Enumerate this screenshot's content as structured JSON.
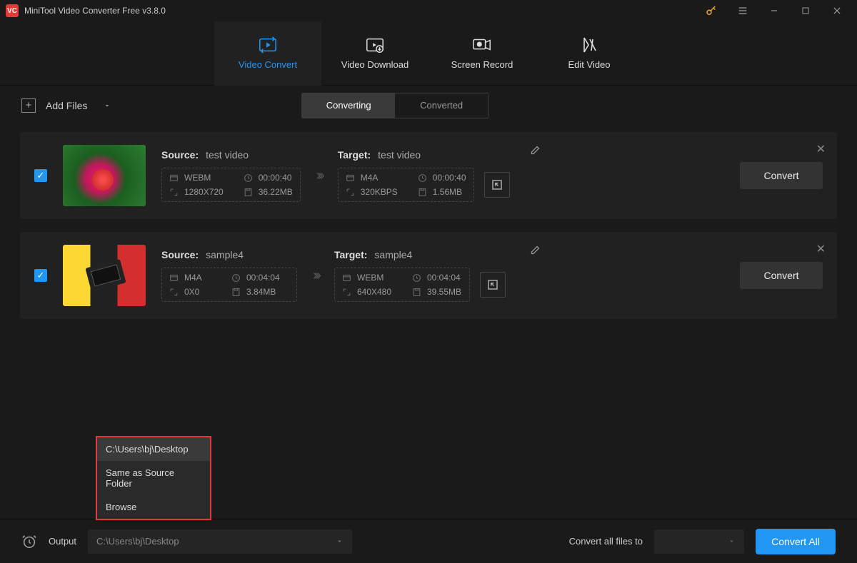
{
  "titlebar": {
    "app_title": "MiniTool Video Converter Free v3.8.0"
  },
  "tabs": {
    "video_convert": "Video Convert",
    "video_download": "Video Download",
    "screen_record": "Screen Record",
    "edit_video": "Edit Video"
  },
  "toolbar": {
    "add_files": "Add Files",
    "converting": "Converting",
    "converted": "Converted"
  },
  "items": [
    {
      "source_label": "Source:",
      "source_name": "test video",
      "source_format": "WEBM",
      "source_duration": "00:00:40",
      "source_resolution": "1280X720",
      "source_size": "36.22MB",
      "target_label": "Target:",
      "target_name": "test video",
      "target_format": "M4A",
      "target_duration": "00:00:40",
      "target_resolution": "320KBPS",
      "target_size": "1.56MB",
      "convert": "Convert"
    },
    {
      "source_label": "Source:",
      "source_name": "sample4",
      "source_format": "M4A",
      "source_duration": "00:04:04",
      "source_resolution": "0X0",
      "source_size": "3.84MB",
      "target_label": "Target:",
      "target_name": "sample4",
      "target_format": "WEBM",
      "target_duration": "00:04:04",
      "target_resolution": "640X480",
      "target_size": "39.55MB",
      "convert": "Convert"
    }
  ],
  "output_popup": {
    "path": "C:\\Users\\bj\\Desktop",
    "same": "Same as Source Folder",
    "browse": "Browse"
  },
  "footer": {
    "output_label": "Output",
    "output_path": "C:\\Users\\bj\\Desktop",
    "convert_all_to": "Convert all files to",
    "convert_all": "Convert All"
  }
}
